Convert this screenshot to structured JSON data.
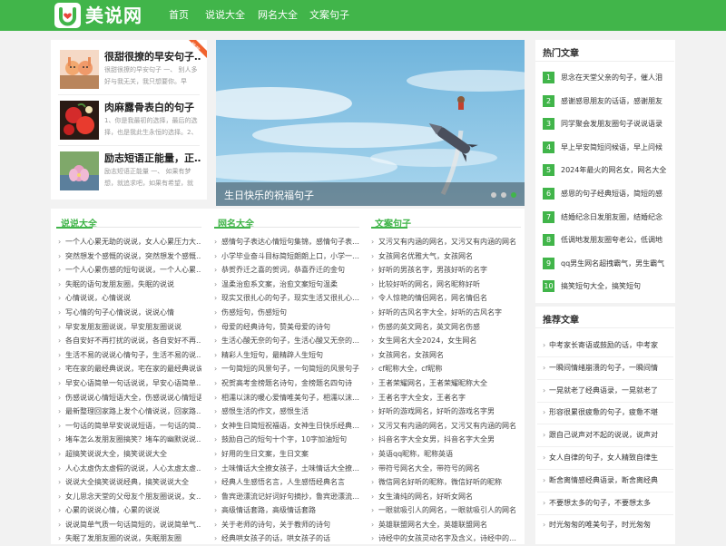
{
  "brand": {
    "logo_text": "美说网",
    "accent": "#41b54a"
  },
  "nav": [
    "首页",
    "说说大全",
    "网名大全",
    "文案句子"
  ],
  "featured": [
    {
      "title": "很甜很撩的早安句子…",
      "desc": "很甜很撩的早安句子 一、 别人多好与我无关，我只想要你。早安！",
      "ribbon": "推荐"
    },
    {
      "title": "肉麻露骨表白的句子",
      "desc": "1、你是我最初的选择，最后的选择，也是我此生永恒的选择。2、"
    },
    {
      "title": "励志短语正能量，正…",
      "desc": "励志短语正能量 一、 如果有梦想，就追求吧，如果有希望，就努"
    }
  ],
  "banner": {
    "title": "生日快乐的祝福句子"
  },
  "columns": [
    {
      "heading": "说说大全",
      "items": [
        "一个人心累无助的说说，女人心累压力大…",
        "突然想发个感慨的说说，突然想发个感慨…",
        "一个人心累伤感的短句说说，一个人心累…",
        "失眠的语句发朋友圈，失眠的说说",
        "心情说说，心情说说",
        "写心情的句子心情说说，说说心情",
        "早安发朋友圈说说，早安朋友圈说说",
        "各自安好不再打扰的说说，各自安好不再…",
        "生活不易的说说心情句子，生活不易的说…",
        "宅在家的最经典说说，宅在家的最经典说说",
        "早安心语简单一句话说说，早安心语简单…",
        "伤感说说心情短语大全，伤感说说心情短语",
        "最新整理回家路上发个心情说说，回家路…",
        "一句话的简单早安说说短语，一句话的简…",
        "堵车怎么发朋友圈搞笑？堵车的幽默说说…",
        "超搞笑说说大全，搞笑说说大全",
        "人心太虚伪太虚假的说说，人心太虚太虚…",
        "说说大全搞笑说说经典，搞笑说说大全",
        "女儿思念天堂的父母友个朋友圈说说，女…",
        "心累的说说心情，心累的说说",
        "说说简单气质一句话简短的，说说简单气…",
        "失眠了发朋友圈的说说，失眠朋友圈"
      ]
    },
    {
      "heading": "网名大全",
      "items": [
        "感情句子表达心情短句集锦，感情句子表…",
        "小学毕业奋斗目标简短朗朗上口，小学一…",
        "恭贺乔迁之喜的贺词，恭喜乔迁的金句",
        "温柔治愈系文案，治愈文案短句温柔",
        "现实又很扎心的句子，现实生活又很扎心…",
        "伤感短句，伤感短句",
        "母爱的经典诗句，赞美母爱的诗句",
        "生活心酸无奈的句子，生活心酸又无奈的…",
        "精彩人生短句，最精辟人生短句",
        "一句简短的风景句子，一句简短的风景句子",
        "祝贺高考金榜题名诗句，金榜题名四句诗",
        "相濡以沫的暖心爱情唯美句子，相濡以沫…",
        "感恨生活的作文，感恨生活",
        "女神生日简短祝福语，女神生日快乐经典…",
        "鼓励自己的短句十个字，10字加油短句",
        "好用的生日文案，生日文案",
        "土味情话大全撩女孩子，土味情话大全撩…",
        "经典人生感悟名言，人生感悟经典名言",
        "鲁宾逊漂流记好词好句摘抄，鲁宾逊漂流…",
        "高级情话套路，高级情话套路",
        "关于老师的诗句，关于教师的诗句",
        "经典哄女孩子的话，哄女孩子的话"
      ]
    },
    {
      "heading": "文案句子",
      "items": [
        "又污又有内涵的网名，又污又有内涵的网名",
        "女孩网名优雅大气，女孩网名",
        "好听的男孩名字，男孩好听的名字",
        "比较好听的网名，网名昵称好听",
        "令人惊艳的情侣网名，网名情侣名",
        "好听的古风名字大全，好听的古风名字",
        "伤感的英文网名，英文网名伤感",
        "女生网名大全2024，女生网名",
        "女孩网名，女孩网名",
        "cf昵称大全，cf昵称",
        "王者荣耀网名，王者荣耀昵称大全",
        "王者名字大全女，王者名字",
        "好听的游戏网名，好听的游戏名字男",
        "又污又有内涵的网名，又污又有内涵的网名",
        "抖音名字大全女男，抖音名字大全男",
        "英语qq昵称，昵称英语",
        "带符号网名大全，带符号的网名",
        "微信网名好听的昵称，微信好听的昵称",
        "女生清纯的网名，好听女网名",
        "一眼就吸引人的网名，一眼就吸引人的网名",
        "英雄联盟网名大全，英雄联盟网名",
        "诗经中的女孩灵动名字及含义，诗经中的…"
      ]
    }
  ],
  "hot": {
    "heading": "热门文章",
    "items": [
      "思念在天堂父亲的句子，催人泪",
      "感谢感恩朋友的话语，感谢朋友",
      "同学聚会发朋友圈句子说说语录",
      "早上早安简短问候语，早上问候",
      "2024年最火的网名女，网名大全",
      "感恩的句子经典短语，简短的感",
      "结婚纪念日发朋友圈，结婚纪念",
      "低调地发朋友圈夸老公，低调地",
      "qq男生网名超拽霸气，男生霸气",
      "搞笑短句大全，搞笑短句"
    ]
  },
  "recommend": {
    "heading": "推荐文章",
    "items": [
      "中考家长寄语或鼓励的话，中考家",
      "一瞬间情绪崩溃的句子，一瞬间情",
      "一晃就老了经典语录，一晃就老了",
      "形容很累很疲惫的句子，疲惫不堪",
      "跟自己说声对不起的说说，说声对",
      "女人自律的句子，女人精致自律生",
      "断舍离情感经典语录，断舍离经典",
      "不要想太多的句子，不要想太多",
      "时光匆匆的唯美句子，时光匆匆"
    ]
  }
}
